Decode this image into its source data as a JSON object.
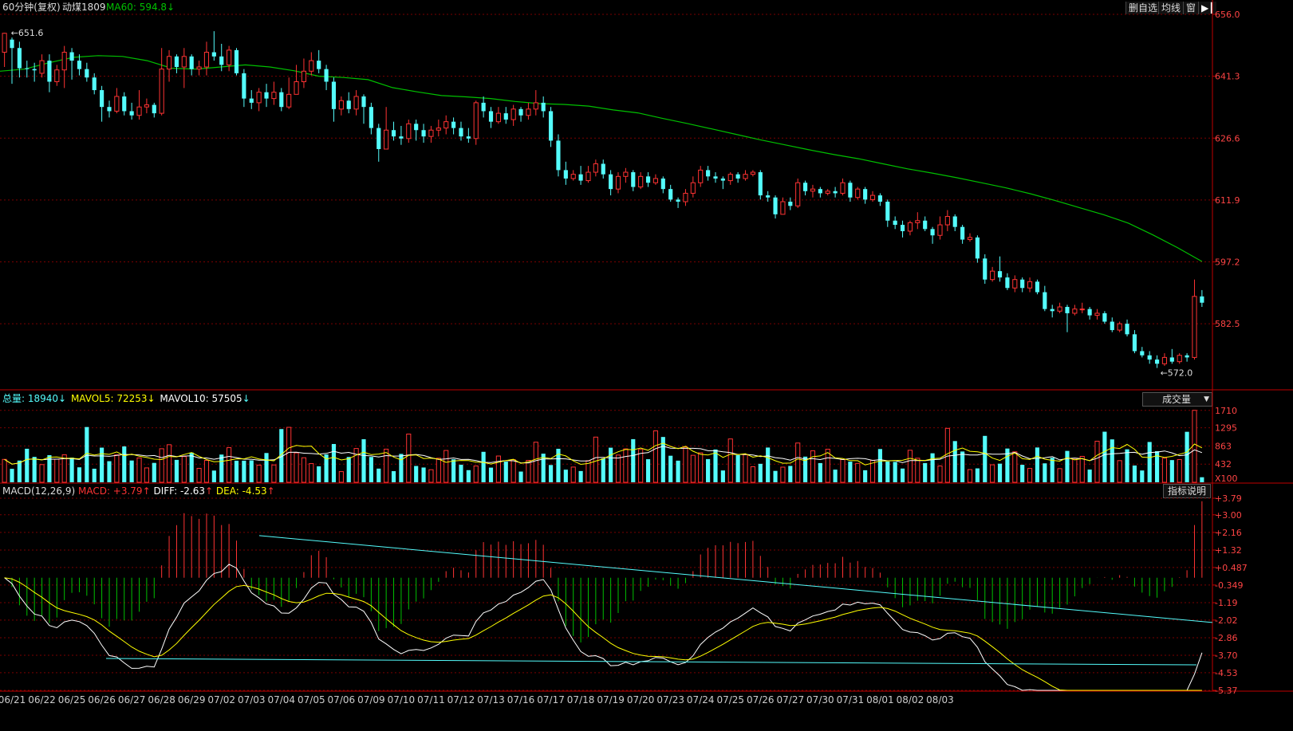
{
  "domain": "Chart",
  "price_panel": {
    "period_label": "60分钟(复权)",
    "symbol": "动煤1809",
    "ma_label": "MA60: 594.8",
    "ma_arrow": "↓",
    "high_mark": "651.6",
    "low_mark": "572.0",
    "buttons": [
      "删自选",
      "均线",
      "窗"
    ],
    "colors": {
      "up": "#ff3333",
      "down": "#54fcfc",
      "ma60": "#00c000",
      "grid": "#7a0000",
      "axis": "#c00000"
    }
  },
  "volume_panel": {
    "total_label": "总量: 18940",
    "total_arrow": "↓",
    "mavol5_label": "MAVOL5: 72253",
    "mavol5_arrow": "↓",
    "mavol10_label": "MAVOL10: 57505",
    "mavol10_arrow": "↓",
    "dropdown": "成交量",
    "unit": "X100",
    "ticks": [
      "1710",
      "1295",
      "863",
      "432"
    ]
  },
  "macd_panel": {
    "title": "MACD(12,26,9)",
    "macd_label": "MACD: +3.79",
    "diff_label": "DIFF: -2.63",
    "dea_label": "DEA: -4.53",
    "up_arrow": "↑",
    "help_button": "指标说明",
    "ticks": [
      "+3.79",
      "+3.00",
      "+2.16",
      "+1.32",
      "+0.487",
      "-0.349",
      "-1.19",
      "-2.02",
      "-2.86",
      "-3.70",
      "-4.53",
      "-5.37"
    ]
  },
  "chart_data": {
    "type": "candlestick",
    "y_ticks": [
      "656.0",
      "641.3",
      "626.6",
      "611.9",
      "597.2",
      "582.5"
    ],
    "ylim": [
      567.0,
      656.0
    ],
    "x_labels": [
      "06/21",
      "06/22",
      "06/25",
      "06/26",
      "06/27",
      "06/28",
      "06/29",
      "07/02",
      "07/03",
      "07/04",
      "07/05",
      "07/06",
      "07/09",
      "07/10",
      "07/11",
      "07/12",
      "07/13",
      "07/16",
      "07/17",
      "07/18",
      "07/19",
      "07/20",
      "07/23",
      "07/24",
      "07/25",
      "07/26",
      "07/27",
      "07/30",
      "07/31",
      "08/01",
      "08/02",
      "08/03"
    ],
    "series": [
      {
        "name": "MA60",
        "values": [
          642.5,
          643.0,
          644.5,
          645.8,
          646.2,
          646.0,
          645.0,
          643.2,
          643.0,
          643.5,
          644.0,
          643.5,
          642.6,
          641.3,
          641.0,
          640.5,
          638.6,
          637.6,
          636.7,
          636.4,
          636.0,
          635.3,
          634.8,
          634.6,
          634.2,
          633.3,
          632.6,
          631.3,
          630.1,
          628.8,
          627.5,
          626.2,
          625.0,
          623.8,
          622.7,
          621.7,
          620.5,
          619.3,
          618.3,
          617.2,
          616.0,
          614.8,
          613.4,
          611.8,
          610.1,
          608.4,
          606.4,
          603.6,
          600.6,
          597.3
        ]
      }
    ],
    "candles_per_day": 4,
    "candles": [
      [
        647.0,
        651.5,
        651.6,
        643.5
      ],
      [
        650.0,
        648.0,
        650.5,
        639.5
      ],
      [
        648.0,
        643.2,
        649.5,
        641.0
      ],
      [
        643.2,
        643.0,
        645.0,
        641.0
      ],
      [
        643.0,
        642.7,
        644.5,
        640.0
      ],
      [
        642.0,
        645.0,
        646.5,
        641.0
      ],
      [
        645.0,
        640.0,
        646.5,
        637.5
      ],
      [
        640.0,
        642.8,
        644.0,
        639.0
      ],
      [
        642.8,
        647.0,
        648.5,
        638.5
      ],
      [
        647.0,
        645.0,
        648.0,
        640.5
      ],
      [
        645.0,
        643.0,
        646.5,
        641.5
      ],
      [
        643.0,
        641.0,
        644.5,
        640.0
      ],
      [
        641.0,
        638.0,
        642.0,
        637.0
      ],
      [
        638.0,
        634.0,
        639.0,
        630.5
      ],
      [
        634.0,
        633.0,
        635.5,
        631.5
      ],
      [
        633.0,
        636.5,
        638.5,
        632.5
      ],
      [
        636.5,
        633.0,
        637.5,
        632.0
      ],
      [
        633.0,
        632.0,
        635.0,
        631.0
      ],
      [
        632.0,
        634.0,
        638.0,
        631.0
      ],
      [
        634.0,
        634.5,
        636.0,
        632.5
      ],
      [
        634.5,
        632.5,
        635.0,
        631.5
      ],
      [
        632.5,
        643.0,
        648.0,
        632.0
      ],
      [
        643.0,
        646.0,
        647.5,
        640.0
      ],
      [
        646.0,
        643.5,
        646.5,
        642.0
      ],
      [
        643.5,
        646.0,
        648.0,
        638.5
      ],
      [
        646.0,
        643.0,
        646.5,
        641.5
      ],
      [
        643.0,
        643.5,
        645.0,
        641.5
      ],
      [
        643.5,
        647.0,
        649.5,
        641.5
      ],
      [
        647.0,
        646.0,
        652.0,
        645.0
      ],
      [
        646.0,
        644.0,
        649.0,
        642.5
      ],
      [
        644.0,
        647.5,
        648.5,
        642.5
      ],
      [
        647.5,
        642.0,
        648.0,
        641.5
      ],
      [
        642.0,
        636.0,
        643.0,
        634.0
      ],
      [
        636.0,
        635.0,
        638.0,
        633.5
      ],
      [
        635.0,
        637.5,
        638.5,
        633.0
      ],
      [
        637.5,
        636.0,
        639.5,
        634.0
      ],
      [
        636.0,
        637.5,
        640.0,
        634.5
      ],
      [
        637.5,
        634.0,
        638.5,
        633.0
      ],
      [
        634.0,
        637.0,
        641.0,
        633.5
      ],
      [
        637.0,
        640.0,
        644.0,
        639.0
      ],
      [
        640.0,
        642.5,
        645.5,
        638.5
      ],
      [
        642.5,
        645.0,
        647.0,
        641.5
      ],
      [
        645.0,
        643.0,
        647.5,
        642.0
      ],
      [
        643.0,
        640.0,
        644.0,
        638.0
      ],
      [
        640.0,
        633.5,
        641.0,
        630.5
      ],
      [
        633.5,
        635.5,
        636.5,
        632.0
      ],
      [
        635.5,
        633.5,
        637.5,
        632.5
      ],
      [
        633.5,
        636.5,
        638.0,
        632.0
      ],
      [
        636.5,
        634.0,
        637.0,
        630.0
      ],
      [
        634.0,
        629.0,
        635.0,
        627.5
      ],
      [
        629.0,
        624.0,
        630.0,
        621.0
      ],
      [
        624.0,
        628.5,
        634.0,
        624.0
      ],
      [
        628.5,
        627.0,
        630.5,
        626.0
      ],
      [
        627.0,
        626.5,
        629.5,
        625.0
      ],
      [
        626.5,
        630.0,
        631.0,
        625.5
      ],
      [
        630.0,
        628.5,
        631.0,
        626.0
      ],
      [
        628.5,
        627.0,
        630.0,
        625.5
      ],
      [
        627.0,
        628.5,
        629.5,
        625.5
      ],
      [
        628.5,
        629.0,
        631.0,
        627.0
      ],
      [
        629.0,
        630.5,
        632.0,
        627.5
      ],
      [
        630.5,
        629.0,
        631.5,
        627.5
      ],
      [
        629.0,
        627.0,
        630.5,
        626.0
      ],
      [
        627.0,
        626.5,
        629.0,
        625.5
      ],
      [
        626.5,
        635.0,
        635.5,
        625.0
      ],
      [
        635.0,
        633.0,
        636.5,
        631.5
      ],
      [
        633.0,
        630.5,
        634.0,
        629.0
      ],
      [
        630.5,
        632.5,
        634.0,
        630.0
      ],
      [
        632.5,
        631.0,
        634.0,
        630.0
      ],
      [
        631.0,
        633.5,
        634.5,
        629.5
      ],
      [
        633.5,
        632.0,
        634.0,
        630.5
      ],
      [
        632.0,
        633.5,
        635.0,
        631.0
      ],
      [
        633.5,
        635.0,
        638.0,
        632.0
      ],
      [
        635.0,
        633.0,
        636.5,
        631.5
      ],
      [
        633.0,
        626.0,
        634.0,
        624.5
      ],
      [
        626.0,
        619.0,
        627.5,
        617.5
      ],
      [
        619.0,
        617.0,
        621.0,
        615.5
      ],
      [
        617.0,
        618.0,
        619.0,
        616.5
      ],
      [
        618.0,
        616.5,
        620.0,
        615.5
      ],
      [
        616.5,
        618.5,
        620.0,
        616.0
      ],
      [
        618.5,
        620.5,
        621.5,
        617.5
      ],
      [
        620.5,
        618.0,
        621.5,
        617.0
      ],
      [
        618.0,
        614.5,
        619.0,
        613.0
      ],
      [
        614.5,
        617.5,
        618.5,
        613.5
      ],
      [
        617.5,
        618.5,
        619.5,
        616.0
      ],
      [
        618.5,
        615.0,
        619.0,
        614.0
      ],
      [
        615.0,
        617.5,
        618.5,
        614.5
      ],
      [
        617.5,
        616.0,
        618.5,
        615.0
      ],
      [
        616.0,
        617.0,
        618.0,
        615.5
      ],
      [
        617.0,
        614.5,
        617.5,
        613.5
      ],
      [
        614.5,
        612.0,
        615.5,
        611.5
      ],
      [
        612.0,
        611.5,
        612.5,
        610.0
      ],
      [
        611.5,
        613.5,
        614.5,
        610.5
      ],
      [
        613.5,
        616.0,
        617.5,
        612.5
      ],
      [
        616.0,
        619.0,
        620.0,
        615.0
      ],
      [
        619.0,
        617.5,
        620.0,
        616.5
      ],
      [
        617.5,
        617.0,
        618.5,
        616.0
      ],
      [
        617.0,
        616.5,
        617.5,
        614.5
      ],
      [
        616.5,
        618.0,
        618.5,
        615.5
      ],
      [
        618.0,
        617.0,
        618.5,
        616.0
      ],
      [
        617.0,
        618.0,
        619.0,
        616.5
      ],
      [
        618.0,
        618.5,
        619.0,
        617.5
      ],
      [
        618.5,
        613.0,
        619.0,
        612.0
      ],
      [
        613.0,
        612.5,
        614.0,
        611.5
      ],
      [
        612.5,
        608.5,
        613.0,
        607.5
      ],
      [
        608.5,
        611.5,
        612.5,
        609.0
      ],
      [
        611.5,
        610.5,
        612.5,
        609.5
      ],
      [
        610.5,
        616.0,
        617.0,
        610.0
      ],
      [
        616.0,
        614.0,
        616.5,
        613.0
      ],
      [
        614.0,
        614.5,
        615.5,
        612.5
      ],
      [
        614.5,
        613.5,
        615.0,
        612.5
      ],
      [
        613.5,
        614.0,
        614.5,
        613.0
      ],
      [
        614.0,
        613.5,
        615.0,
        612.5
      ],
      [
        613.5,
        616.0,
        617.0,
        613.0
      ],
      [
        616.0,
        612.5,
        616.5,
        611.5
      ],
      [
        612.5,
        614.5,
        615.0,
        612.0
      ],
      [
        614.5,
        612.0,
        615.0,
        611.0
      ],
      [
        612.0,
        613.0,
        614.0,
        611.5
      ],
      [
        613.0,
        611.5,
        613.5,
        610.5
      ],
      [
        611.5,
        607.0,
        612.0,
        605.5
      ],
      [
        607.0,
        606.0,
        608.0,
        605.0
      ],
      [
        606.0,
        604.5,
        607.0,
        603.0
      ],
      [
        604.5,
        606.5,
        607.0,
        603.5
      ],
      [
        606.5,
        607.0,
        609.0,
        605.0
      ],
      [
        607.0,
        605.0,
        608.0,
        604.5
      ],
      [
        605.0,
        603.5,
        605.5,
        601.5
      ],
      [
        603.5,
        606.0,
        608.0,
        602.5
      ],
      [
        606.0,
        608.0,
        609.5,
        604.5
      ],
      [
        608.0,
        605.5,
        608.5,
        604.5
      ],
      [
        605.5,
        602.5,
        606.0,
        601.5
      ],
      [
        602.5,
        603.0,
        604.0,
        602.0
      ],
      [
        603.0,
        598.0,
        603.5,
        597.0
      ],
      [
        598.0,
        593.0,
        599.0,
        592.0
      ],
      [
        593.0,
        595.0,
        596.0,
        592.5
      ],
      [
        595.0,
        593.5,
        598.5,
        592.5
      ],
      [
        593.5,
        591.0,
        594.5,
        590.5
      ],
      [
        591.0,
        593.0,
        594.0,
        590.0
      ],
      [
        593.0,
        591.0,
        593.5,
        590.0
      ],
      [
        591.0,
        592.5,
        593.5,
        590.0
      ],
      [
        592.5,
        590.0,
        593.0,
        589.5
      ],
      [
        590.0,
        586.0,
        591.5,
        585.5
      ],
      [
        586.0,
        585.5,
        587.0,
        584.0
      ],
      [
        585.5,
        586.5,
        587.5,
        585.0
      ],
      [
        586.5,
        585.0,
        587.0,
        580.5
      ],
      [
        585.0,
        586.0,
        587.0,
        584.5
      ],
      [
        586.0,
        586.0,
        587.5,
        585.0
      ],
      [
        586.0,
        584.5,
        586.5,
        583.5
      ],
      [
        584.5,
        585.0,
        586.0,
        583.5
      ],
      [
        585.0,
        583.0,
        585.5,
        582.5
      ],
      [
        583.0,
        581.0,
        584.0,
        580.5
      ],
      [
        581.0,
        582.5,
        583.0,
        580.5
      ],
      [
        582.5,
        580.0,
        583.5,
        579.5
      ],
      [
        580.0,
        576.0,
        581.0,
        575.5
      ],
      [
        576.0,
        575.0,
        577.0,
        574.5
      ],
      [
        575.0,
        574.0,
        576.0,
        573.0
      ],
      [
        574.0,
        573.0,
        575.0,
        572.0
      ],
      [
        573.0,
        574.5,
        575.5,
        572.5
      ],
      [
        574.5,
        573.5,
        576.5,
        573.0
      ],
      [
        573.5,
        575.0,
        575.5,
        573.0
      ],
      [
        575.0,
        574.5,
        575.5,
        573.5
      ],
      [
        574.5,
        589.0,
        593.0,
        574.0
      ],
      [
        589.0,
        587.5,
        590.5,
        586.5
      ]
    ]
  }
}
